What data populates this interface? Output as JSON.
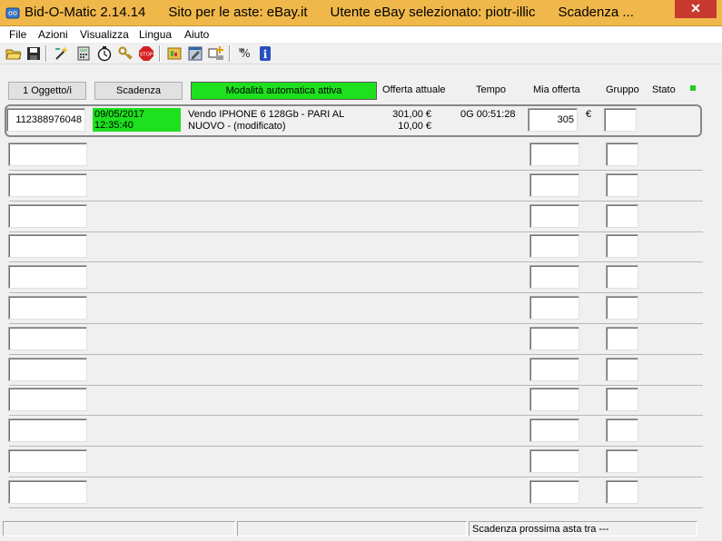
{
  "window": {
    "title": "Bid-O-Matic 2.14.14      Sito per le aste: eBay.it      Utente eBay selezionato: piotr-illic      Scadenza ...",
    "close_glyph": "✕"
  },
  "menu": [
    "File",
    "Azioni",
    "Visualizza",
    "Lingua",
    "Aiuto"
  ],
  "toolbar": {
    "icons": [
      "open-folder-icon",
      "save-disk-icon",
      "wizard-icon",
      "calculator-icon",
      "stopwatch-icon",
      "key-icon",
      "stop-sign-icon",
      "folder-gear-icon",
      "edit-window-icon",
      "add-item-icon",
      "currency-icon",
      "info-icon"
    ]
  },
  "header": {
    "items_button": "1 Oggetto/i",
    "deadline_button": "Scadenza",
    "auto_mode_button": "Modalità automatica attiva",
    "col_current_bid": "Offerta attuale",
    "col_time": "Tempo",
    "col_my_bid": "Mia offerta",
    "col_group": "Gruppo",
    "col_status": "Stato"
  },
  "auctions": [
    {
      "item_id": "112388976048",
      "date": "09/05/2017",
      "time": "12:35:40",
      "desc_line1": "Vendo IPHONE 6 128Gb - PARI AL",
      "desc_line2": "NUOVO - (modificato)",
      "current_bid": "301,00 €",
      "shipping": "10,00 €",
      "time_left": "0G 00:51:28",
      "my_bid": "305",
      "currency": "€",
      "group": ""
    }
  ],
  "empty_rows": 12,
  "statusbar": {
    "panel1": "",
    "panel2": "",
    "panel3": "Scadenza prossima asta tra ---"
  },
  "colors": {
    "title_bar": "#f0b84a",
    "active_green": "#1ee01e",
    "close_red": "#c7392f"
  }
}
